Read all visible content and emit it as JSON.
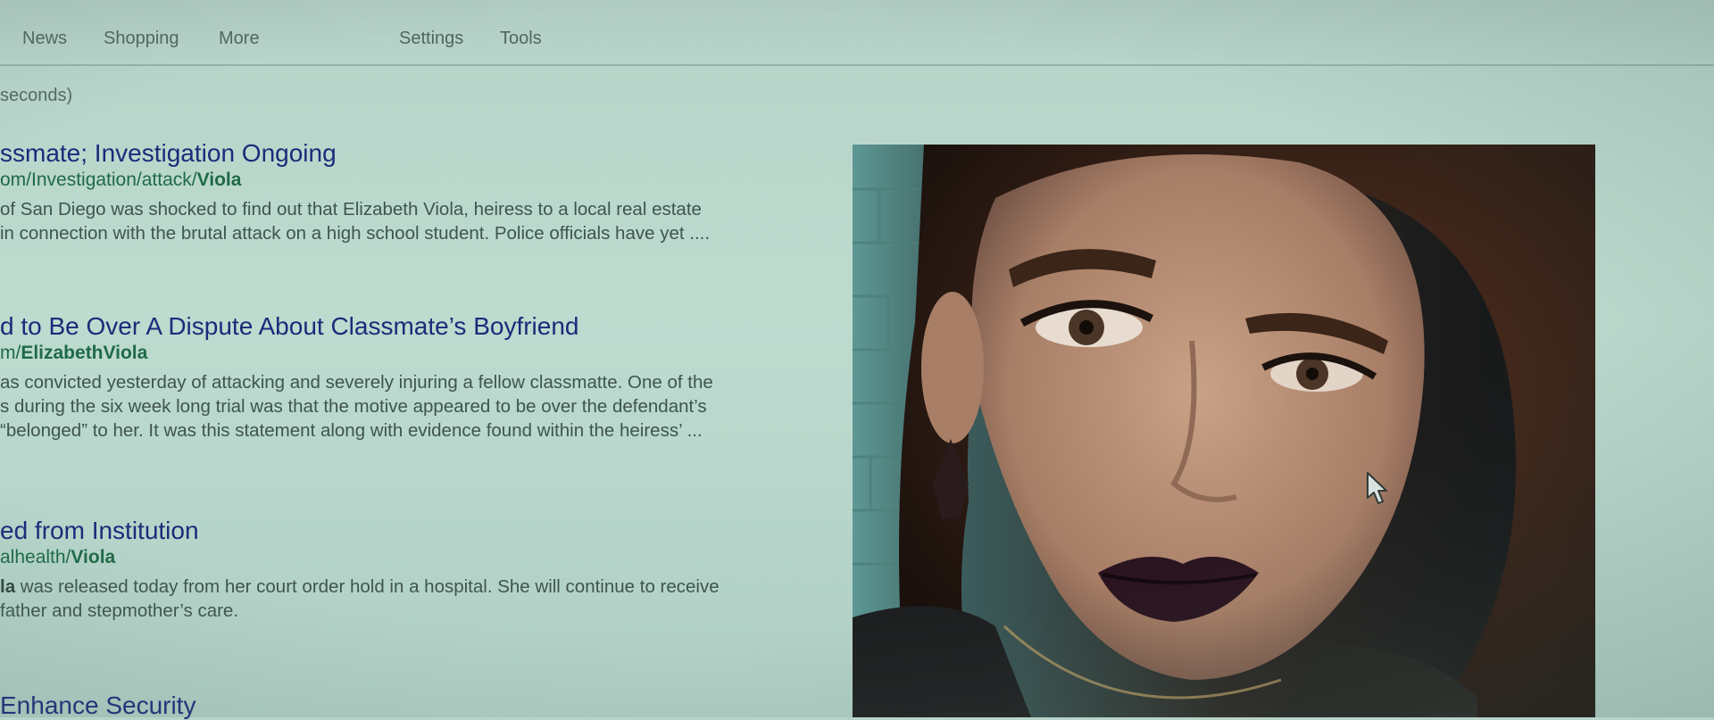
{
  "nav": {
    "items": [
      "News",
      "Shopping",
      "More"
    ],
    "settings": "Settings",
    "tools": "Tools"
  },
  "stats": "seconds)",
  "results": [
    {
      "title": "ssmate; Investigation Ongoing",
      "url_prefix": "om/Investigation/attack/",
      "url_bold": "Viola",
      "snippet": [
        "of San Diego was shocked to find out that Elizabeth Viola, heiress to a local real estate",
        "in connection with the brutal attack on a high school student.  Police officials have yet ...."
      ]
    },
    {
      "title": "d to Be Over A Dispute About Classmate’s Boyfriend",
      "url_prefix": "m/",
      "url_bold": "ElizabethViola",
      "snippet": [
        "as convicted yesterday of attacking and severely injuring a fellow classmatte.  One of the",
        "s during the six week long trial was that the motive appeared to be over the  defendant’s",
        "“belonged” to her.  It was this statement along with evidence found within  the heiress’ ..."
      ]
    },
    {
      "title": "ed from Institution",
      "url_prefix": "alhealth/",
      "url_bold": "Viola",
      "snippet_bold": "la",
      "snippet": [
        " was released today from her court order hold in a hospital.  She will continue to  receive",
        " father and stepmother’s care."
      ]
    },
    {
      "title": "Enhance Security"
    }
  ],
  "image": {
    "subject": "portrait-photo",
    "colors": {
      "brick": "#6fa7a3",
      "skin": "#b58d73",
      "hair": "#3a2418",
      "lips": "#2a1420"
    }
  },
  "colors": {
    "background": "#bddbcf",
    "link": "#1d2a7a",
    "url": "#1f6a47",
    "text": "#3f544e"
  }
}
